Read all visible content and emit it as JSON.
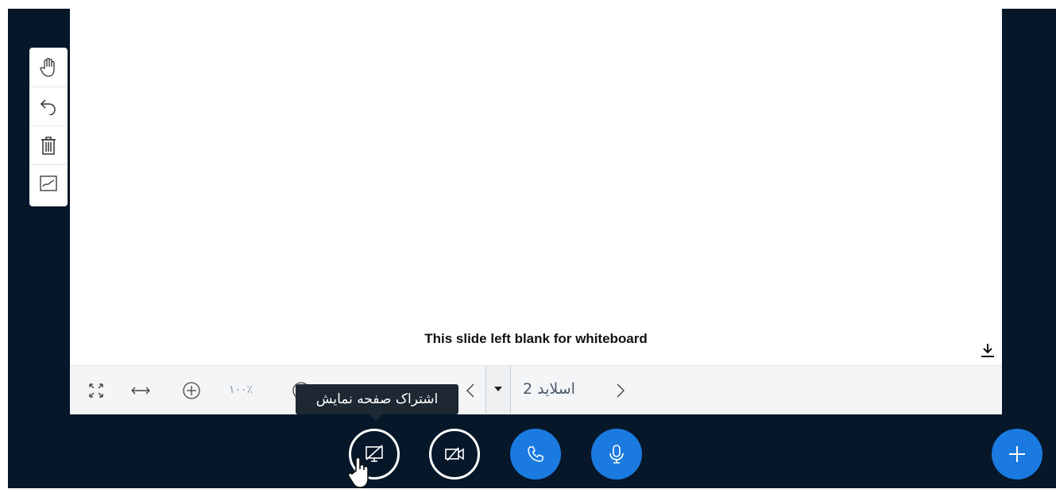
{
  "slide": {
    "text": "This slide left blank for whiteboard"
  },
  "side_toolbar": {
    "tools": [
      {
        "icon": "hand-tool-icon"
      },
      {
        "icon": "undo-icon"
      },
      {
        "icon": "trash-icon"
      },
      {
        "icon": "whiteboard-chart-icon"
      }
    ]
  },
  "presentation_toolbar": {
    "zoom_value": "۱۰۰٪",
    "slide_label": "اسلاید 2",
    "icons": [
      "fullscreen-icon",
      "fit-width-icon",
      "zoom-in-icon",
      "zoom-out-icon",
      "prev-slide-icon",
      "next-slide-icon",
      "download-icon"
    ]
  },
  "tooltip": {
    "text": "اشتراک صفحه نمایش"
  },
  "actions": {
    "buttons": [
      "screen-share-icon",
      "video-off-icon",
      "phone-icon",
      "microphone-icon",
      "plus-icon"
    ]
  },
  "colors": {
    "app_background": "#06172a",
    "accent_blue": "#1a7ae0",
    "tooltip_background": "#1e2833"
  }
}
